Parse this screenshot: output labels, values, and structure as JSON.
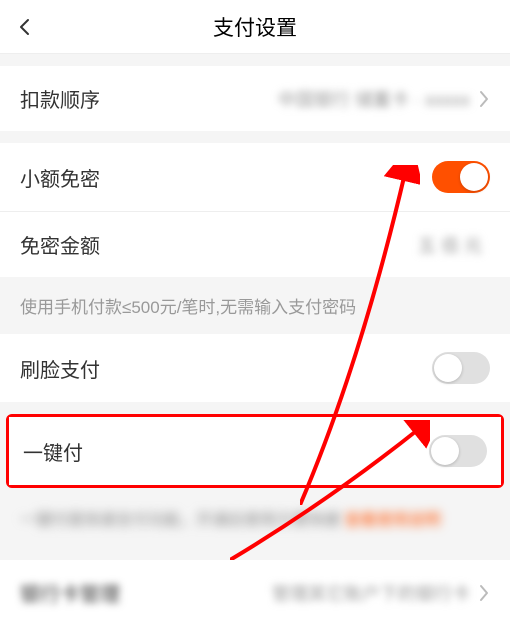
{
  "header": {
    "title": "支付设置"
  },
  "rows": {
    "deduction_order": {
      "label": "扣款顺序",
      "value": "中国银行 储蓄卡 · xxxxx"
    },
    "small_amount": {
      "label": "小额免密"
    },
    "exempt_amount": {
      "label": "免密金额",
      "value": "五 佰 元"
    },
    "face_pay": {
      "label": "刷脸支付"
    },
    "one_click_pay": {
      "label": "一键付"
    },
    "bank_manage": {
      "label": "银行卡管理",
      "value": "管理其它账户下的银行卡"
    }
  },
  "hint": "使用手机付款≤500元/笔时,无需输入支付密码",
  "blurred": {
    "text": "一键付是快速支付功能，开通后使用方便快捷",
    "link": "查看使用说明"
  }
}
